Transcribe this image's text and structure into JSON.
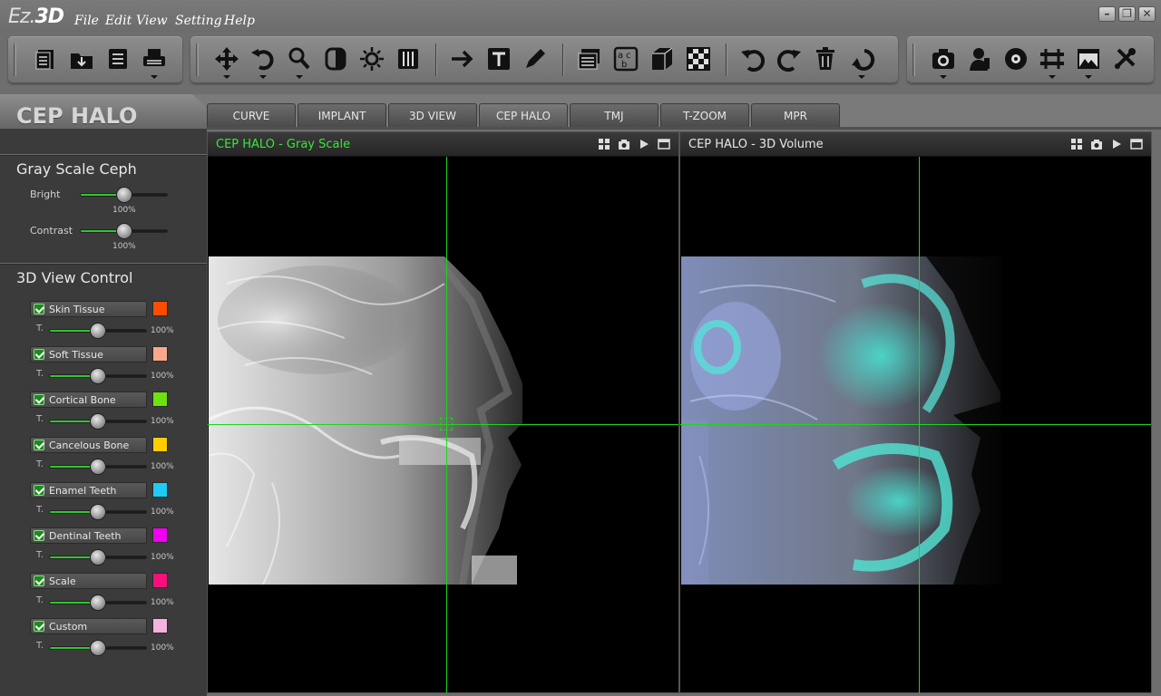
{
  "app": {
    "logo_prefix": "Ez.",
    "logo_main": "3D"
  },
  "menu": {
    "file": "File",
    "edit": "Edit",
    "view": "View",
    "setting": "Setting",
    "help": "Help"
  },
  "window_controls": {
    "minimize": "–",
    "restore": "❐",
    "close": "✕"
  },
  "mode_title": "CEP HALO",
  "tabs": [
    {
      "label": "CURVE"
    },
    {
      "label": "IMPLANT"
    },
    {
      "label": "3D VIEW"
    },
    {
      "label": "CEP HALO",
      "active": true
    },
    {
      "label": "TMJ"
    },
    {
      "label": "T-ZOOM"
    },
    {
      "label": "MPR"
    }
  ],
  "gray_scale": {
    "title": "Gray Scale Ceph",
    "bright": {
      "label": "Bright",
      "value": "100%",
      "level": 0.5
    },
    "contrast": {
      "label": "Contrast",
      "value": "100%",
      "level": 0.5
    }
  },
  "view_control": {
    "title": "3D View Control",
    "t_label": "T.",
    "layers": [
      {
        "name": "Skin Tissue",
        "color": "#ff4c00",
        "value": "100%",
        "level": 0.5,
        "checked": true
      },
      {
        "name": "Soft Tissue",
        "color": "#f9a98a",
        "value": "100%",
        "level": 0.5,
        "checked": true
      },
      {
        "name": "Cortical Bone",
        "color": "#6fe010",
        "value": "100%",
        "level": 0.5,
        "checked": true
      },
      {
        "name": "Cancelous Bone",
        "color": "#ffcc00",
        "value": "100%",
        "level": 0.5,
        "checked": true
      },
      {
        "name": "Enamel Teeth",
        "color": "#1ecbf5",
        "value": "100%",
        "level": 0.5,
        "checked": true
      },
      {
        "name": "Dentinal Teeth",
        "color": "#f000f0",
        "value": "100%",
        "level": 0.5,
        "checked": true
      },
      {
        "name": "Scale",
        "color": "#f5107a",
        "value": "100%",
        "level": 0.5,
        "checked": true
      },
      {
        "name": "Custom",
        "color": "#f5b2dc",
        "value": "100%",
        "level": 0.5,
        "checked": true
      }
    ]
  },
  "viewports": {
    "left": {
      "title": "CEP HALO - Gray Scale",
      "title_color": "#39e639"
    },
    "right": {
      "title": "CEP HALO - 3D Volume",
      "title_color": "#e6e6e6"
    }
  },
  "toolbar_icons": [
    "new-file-icon",
    "open-folder-icon",
    "save-icon",
    "print-icon",
    "move-icon",
    "rotate-icon",
    "zoom-icon",
    "contrast-icon",
    "brightness-icon",
    "film-icon",
    "arrow-icon",
    "text-icon",
    "pencil-icon",
    "layers-icon",
    "abc-icon",
    "cube-icon",
    "checker-icon",
    "undo-icon",
    "redo-icon",
    "trash-icon",
    "reset-icon",
    "camera-icon",
    "patient-icon",
    "disc-icon",
    "export-icon",
    "image-icon",
    "tools-icon"
  ]
}
